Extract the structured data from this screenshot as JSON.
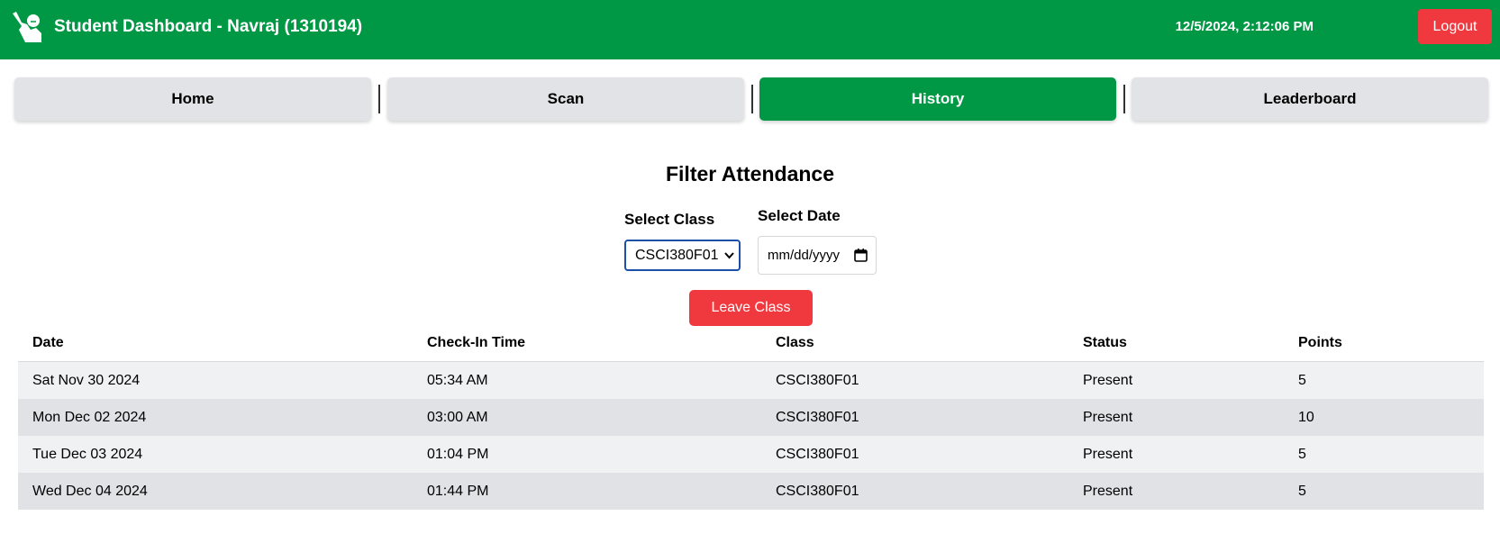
{
  "header": {
    "title": "Student Dashboard - Navraj (1310194)",
    "datetime": "12/5/2024, 2:12:06 PM",
    "logout_label": "Logout",
    "logo_icon": "raised-hand-icon",
    "brand_color": "#009845"
  },
  "nav": {
    "tabs": [
      {
        "label": "Home",
        "active": false
      },
      {
        "label": "Scan",
        "active": false
      },
      {
        "label": "History",
        "active": true
      },
      {
        "label": "Leaderboard",
        "active": false
      }
    ]
  },
  "filter": {
    "title": "Filter Attendance",
    "class_label": "Select Class",
    "class_value": "CSCI380F01",
    "date_label": "Select Date",
    "date_placeholder": "mm/dd/yyyy",
    "leave_label": "Leave Class",
    "danger_color": "#f0383f"
  },
  "table": {
    "columns": [
      "Date",
      "Check-In Time",
      "Class",
      "Status",
      "Points"
    ],
    "rows": [
      [
        "Sat Nov 30 2024",
        "05:34 AM",
        "CSCI380F01",
        "Present",
        "5"
      ],
      [
        "Mon Dec 02 2024",
        "03:00 AM",
        "CSCI380F01",
        "Present",
        "10"
      ],
      [
        "Tue Dec 03 2024",
        "01:04 PM",
        "CSCI380F01",
        "Present",
        "5"
      ],
      [
        "Wed Dec 04 2024",
        "01:44 PM",
        "CSCI380F01",
        "Present",
        "5"
      ]
    ]
  }
}
